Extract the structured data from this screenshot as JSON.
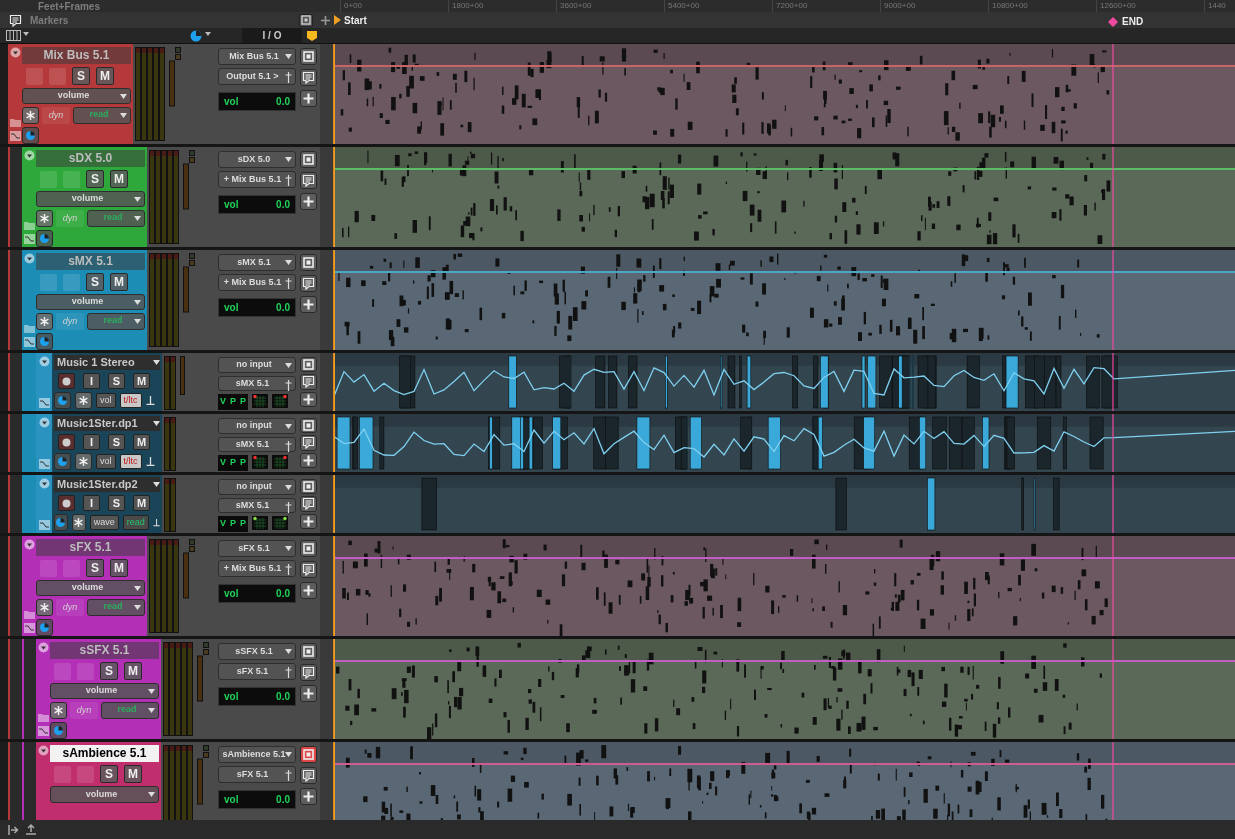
{
  "ruler": {
    "title": "Feet+Frames",
    "ticks": [
      "0+00",
      "1800+00",
      "3600+00",
      "5400+00",
      "7200+00",
      "9000+00",
      "10800+00",
      "12600+00",
      "1440"
    ]
  },
  "markers": {
    "title": "Markers",
    "start": "Start",
    "end": "END"
  },
  "toolbar": {
    "io_label": "I / O"
  },
  "tracks": [
    {
      "name": "Mix Bus 5.1",
      "kind": "aux",
      "color": "#b5393a",
      "name_selected": false,
      "buttons": [
        "S",
        "M"
      ],
      "view": "volume",
      "automation": {
        "dyn": "dyn",
        "mode": "read"
      },
      "input": "Mix Bus 5.1",
      "output": "Output 5.1 >",
      "fader": {
        "label": "vol",
        "value": "0.0"
      },
      "io_active": false,
      "children": [
        {
          "name": "sDX 5.0",
          "kind": "aux",
          "color": "#2ea83a",
          "name_selected": false,
          "buttons": [
            "S",
            "M"
          ],
          "view": "volume",
          "automation": {
            "dyn": "dyn",
            "mode": "read"
          },
          "input": "sDX 5.0",
          "output": "+ Mix Bus 5.1",
          "fader": {
            "label": "vol",
            "value": "0.0"
          },
          "io_active": false
        },
        {
          "name": "sMX 5.1",
          "kind": "aux",
          "color": "#1c8db5",
          "name_selected": false,
          "buttons": [
            "S",
            "M"
          ],
          "view": "volume",
          "automation": {
            "dyn": "dyn",
            "mode": "read"
          },
          "input": "sMX 5.1",
          "output": "+ Mix Bus 5.1",
          "fader": {
            "label": "vol",
            "value": "0.0"
          },
          "io_active": false,
          "children": [
            {
              "name": "Music 1 Stereo",
              "kind": "audio",
              "color": "#2a93c0",
              "name_selected": false,
              "buttons": [
                "I",
                "S",
                "M"
              ],
              "view": "vol",
              "mode": {
                "text": "t/ltc",
                "kind": "trim"
              },
              "input": "no input",
              "output": "sMX 5.1",
              "flags": [
                "V",
                "P",
                "P"
              ],
              "clipped": true
            },
            {
              "name": "Music1Ster.dp1",
              "kind": "audio",
              "color": "#2a93c0",
              "name_selected": false,
              "buttons": [
                "I",
                "S",
                "M"
              ],
              "view": "vol",
              "mode": {
                "text": "t/ltc",
                "kind": "trim"
              },
              "input": "no input",
              "output": "sMX 5.1",
              "flags": [
                "V",
                "P",
                "P"
              ],
              "clipped": true
            },
            {
              "name": "Music1Ster.dp2",
              "kind": "audio",
              "color": "#2a93c0",
              "name_selected": false,
              "buttons": [
                "I",
                "S",
                "M"
              ],
              "view": "wave",
              "mode": {
                "text": "read",
                "kind": "read"
              },
              "input": "no input",
              "output": "sMX 5.1",
              "flags": [
                "V",
                "P",
                "P"
              ],
              "clipped": false
            }
          ]
        },
        {
          "name": "sFX 5.1",
          "kind": "aux",
          "color": "#b22fb6",
          "name_selected": false,
          "buttons": [
            "S",
            "M"
          ],
          "view": "volume",
          "automation": {
            "dyn": "dyn",
            "mode": "read"
          },
          "input": "sFX 5.1",
          "output": "+ Mix Bus 5.1",
          "fader": {
            "label": "vol",
            "value": "0.0"
          },
          "io_active": false,
          "children": [
            {
              "name": "sSFX 5.1",
              "kind": "aux",
              "color": "#b22fb6",
              "name_selected": false,
              "buttons": [
                "S",
                "M"
              ],
              "view": "volume",
              "automation": {
                "dyn": "dyn",
                "mode": "read"
              },
              "input": "sSFX 5.1",
              "output": "sFX 5.1",
              "fader": {
                "label": "vol",
                "value": "0.0"
              },
              "io_active": false
            },
            {
              "name": "sAmbience 5.1",
              "kind": "aux",
              "color": "#c02e6e",
              "name_selected": true,
              "buttons": [
                "S",
                "M"
              ],
              "view": "volume",
              "input": "sAmbience 5.1",
              "output": "sFX 5.1",
              "fader": {
                "label": "vol",
                "value": "0.0"
              },
              "io_active": true
            }
          ]
        }
      ]
    }
  ]
}
